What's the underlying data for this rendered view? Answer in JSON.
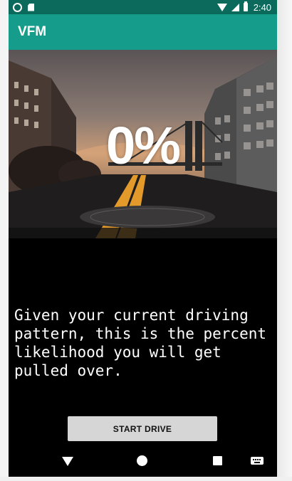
{
  "status_bar": {
    "time": "2:40",
    "icons": [
      "circle-icon",
      "sd-card-icon",
      "wifi-icon",
      "signal-icon",
      "battery-icon"
    ]
  },
  "app_bar": {
    "title": "VFM"
  },
  "hero": {
    "percent_text": "0%"
  },
  "message": {
    "text": "Given your current driving pattern, this is the percent likelihood you will get pulled over."
  },
  "start_button": {
    "label": "START DRIVE"
  },
  "nav_bar": {
    "icons": [
      "back-icon",
      "home-icon",
      "recents-icon",
      "keyboard-icon"
    ]
  },
  "colors": {
    "status_bar": "#0b6a5c",
    "app_bar": "#169c8a",
    "background": "#000000",
    "button": "#d6d6d6"
  }
}
